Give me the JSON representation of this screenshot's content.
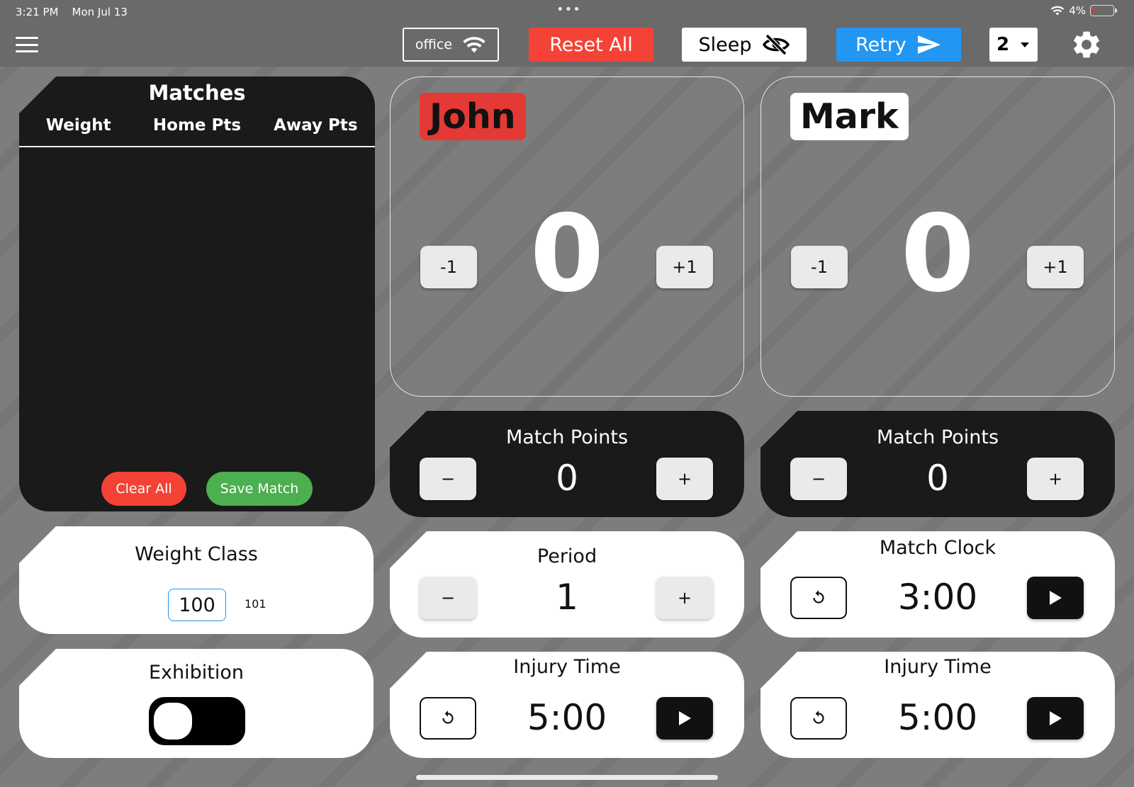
{
  "status_bar": {
    "time": "3:21 PM",
    "date": "Mon Jul 13",
    "battery": "4%"
  },
  "toolbar": {
    "network_label": "office",
    "reset_label": "Reset All",
    "sleep_label": "Sleep",
    "retry_label": "Retry",
    "count_value": "2"
  },
  "colors": {
    "reset": "#f44336",
    "retry": "#2196f3",
    "save": "#4caf50",
    "home_tag": "#e53935"
  },
  "matches": {
    "title": "Matches",
    "columns": [
      "Weight",
      "Home Pts",
      "Away Pts"
    ],
    "clear_label": "Clear All",
    "save_label": "Save Match"
  },
  "home": {
    "name": "John",
    "score": "0",
    "minus_label": "-1",
    "plus_label": "+1"
  },
  "away": {
    "name": "Mark",
    "score": "0",
    "minus_label": "-1",
    "plus_label": "+1"
  },
  "home_match_points": {
    "title": "Match Points",
    "value": "0",
    "minus_label": "−",
    "plus_label": "+"
  },
  "away_match_points": {
    "title": "Match Points",
    "value": "0",
    "minus_label": "−",
    "plus_label": "+"
  },
  "weight_class": {
    "title": "Weight Class",
    "selected": "100",
    "next": "101"
  },
  "exhibition": {
    "title": "Exhibition"
  },
  "period": {
    "title": "Period",
    "value": "1",
    "minus_label": "−",
    "plus_label": "+"
  },
  "match_clock": {
    "title": "Match Clock",
    "value": "3:00"
  },
  "injury_home": {
    "title": "Injury Time",
    "value": "5:00"
  },
  "injury_away": {
    "title": "Injury Time",
    "value": "5:00"
  }
}
